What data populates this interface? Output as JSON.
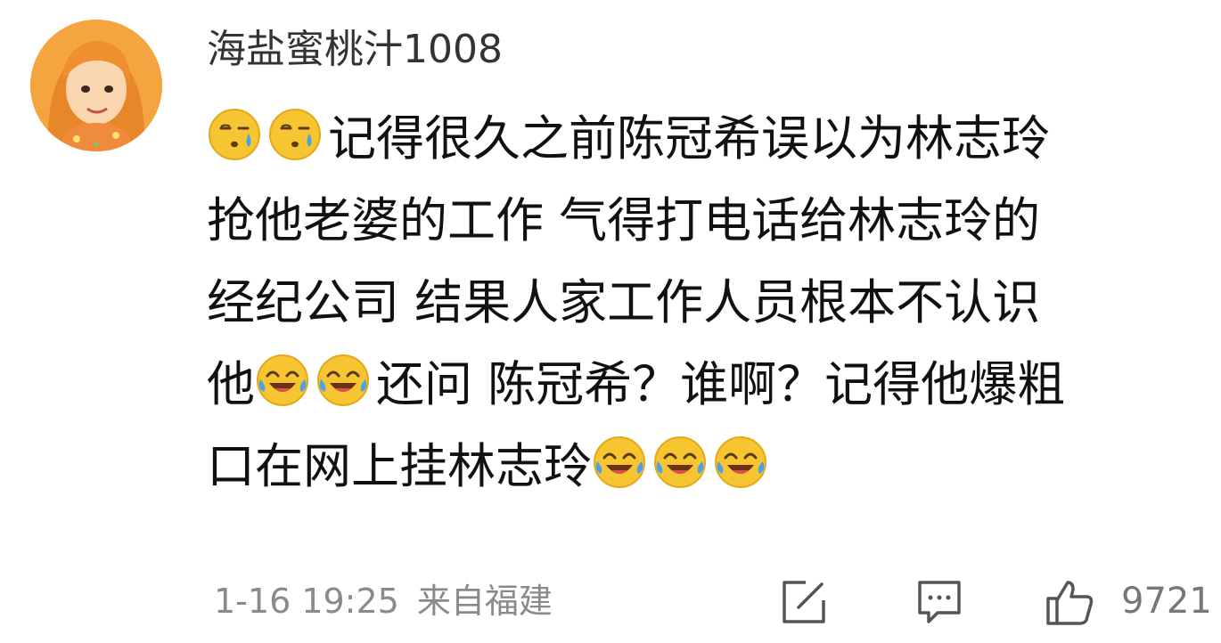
{
  "comment": {
    "username": "海盐蜜桃汁1008",
    "lines": [
      {
        "text_before": "",
        "emojis_before": [
          "sweat-face",
          "sweat-face"
        ],
        "text": "记得很久之前陈冠希误以为林志玲",
        "emojis_after": []
      },
      {
        "text_before": "",
        "emojis_before": [],
        "text": "抢他老婆的工作 气得打电话给林志玲的",
        "emojis_after": []
      },
      {
        "text_before": "",
        "emojis_before": [],
        "text": "经纪公司 结果人家工作人员根本不认识",
        "emojis_after": []
      }
    ],
    "line4": {
      "start": "他",
      "end": "还问 陈冠希？谁啊？记得他爆粗"
    },
    "line5": {
      "text": "口在网上挂林志玲"
    },
    "emoji_names": {
      "sweat": "sweat-face-emoji",
      "laugh": "laugh-cry-emoji"
    }
  },
  "footer": {
    "date": "1-16 19:25",
    "location": "来自福建",
    "like_count": "9721",
    "icons": [
      "share-icon",
      "reply-icon",
      "thumbs-up-icon"
    ]
  },
  "colors": {
    "text": "#111111",
    "meta": "#8a8a8a",
    "emoji_yellow": "#f7c531",
    "avatar_orange": "#f3a23a"
  }
}
